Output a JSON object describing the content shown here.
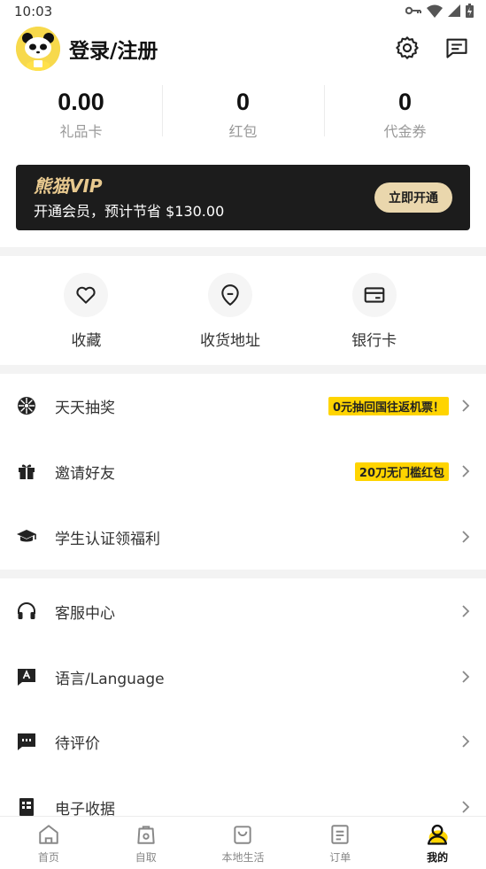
{
  "status_bar": {
    "time": "10:03"
  },
  "header": {
    "login_text": "登录/注册"
  },
  "stats": [
    {
      "value": "0.00",
      "label": "礼品卡"
    },
    {
      "value": "0",
      "label": "红包"
    },
    {
      "value": "0",
      "label": "代金券"
    }
  ],
  "vip": {
    "logo": "熊猫VIP",
    "description": "开通会员，预计节省 $130.00",
    "button_label": "立即开通"
  },
  "quick_actions": [
    {
      "label": "收藏",
      "icon": "heart-icon"
    },
    {
      "label": "收货地址",
      "icon": "location-pin-icon"
    },
    {
      "label": "银行卡",
      "icon": "credit-card-icon"
    }
  ],
  "menu_group_1": [
    {
      "label": "天天抽奖",
      "icon": "lottery-wheel-icon",
      "badge": "0元抽回国往返机票！"
    },
    {
      "label": "邀请好友",
      "icon": "gift-icon",
      "badge": "20刀无门槛红包"
    },
    {
      "label": "学生认证领福利",
      "icon": "graduation-cap-icon",
      "badge": ""
    }
  ],
  "menu_group_2": [
    {
      "label": "客服中心",
      "icon": "headset-icon"
    },
    {
      "label": "语言/Language",
      "icon": "language-icon"
    },
    {
      "label": "待评价",
      "icon": "comment-icon"
    },
    {
      "label": "电子收据",
      "icon": "receipt-icon"
    }
  ],
  "tabbar": [
    {
      "label": "首页",
      "icon": "home-icon",
      "active": false
    },
    {
      "label": "自取",
      "icon": "pickup-bag-icon",
      "active": false
    },
    {
      "label": "本地生活",
      "icon": "local-life-icon",
      "active": false
    },
    {
      "label": "订单",
      "icon": "order-list-icon",
      "active": false
    },
    {
      "label": "我的",
      "icon": "profile-icon",
      "active": true
    }
  ],
  "colors": {
    "accent_yellow": "#ffd400",
    "vip_background": "#1c1c1c",
    "vip_gold": "#e8c98f",
    "vip_button": "#ead7ad"
  }
}
